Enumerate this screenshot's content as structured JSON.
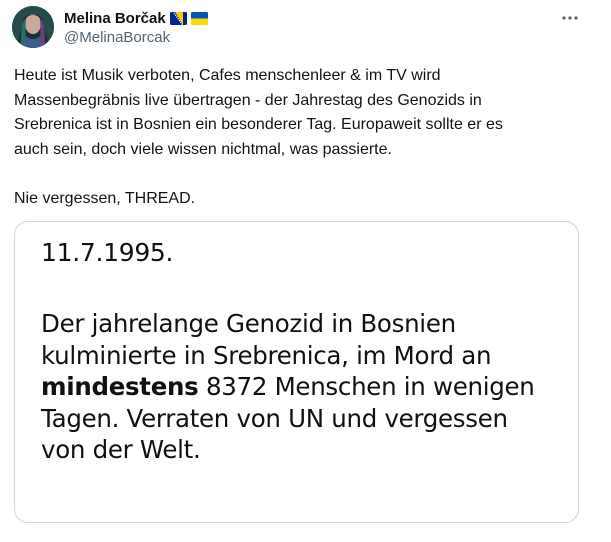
{
  "author": {
    "display_name": "Melina Borčak",
    "handle": "@MelinaBorcak",
    "flags": [
      "bosnia-flag-icon",
      "ukraine-flag-icon"
    ]
  },
  "menu": {
    "icon": "more-horizontal-icon"
  },
  "tweet_text": "Heute ist Musik verboten, Cafes menschenleer & im TV wird\nMassenbegräbnis live übertragen - der Jahrestag des Genozids in\nSrebrenica ist in Bosnien ein besonderer Tag. Europaweit sollte er es\nauch sein, doch viele wissen nichtmal, was passierte.\n\nNie vergessen, THREAD.",
  "media": {
    "date": "11.7.1995.",
    "line1": "Der jahrelange Genozid in Bosnien",
    "line2": "kulminierte in Srebrenica, im Mord an",
    "emphasis": "mindestens",
    "line3_rest": " 8372 Menschen in wenigen",
    "line4": "Tagen. Verraten von UN und vergessen",
    "line5": "von der Welt."
  },
  "colors": {
    "text": "#0f1419",
    "secondary": "#536471",
    "card_border": "#d0d7de",
    "flag_blue_bosnia": "#002395",
    "flag_yellow": "#fecb00",
    "flag_blue_ukraine": "#0057b7",
    "flag_yellow_ukraine": "#ffd700"
  }
}
